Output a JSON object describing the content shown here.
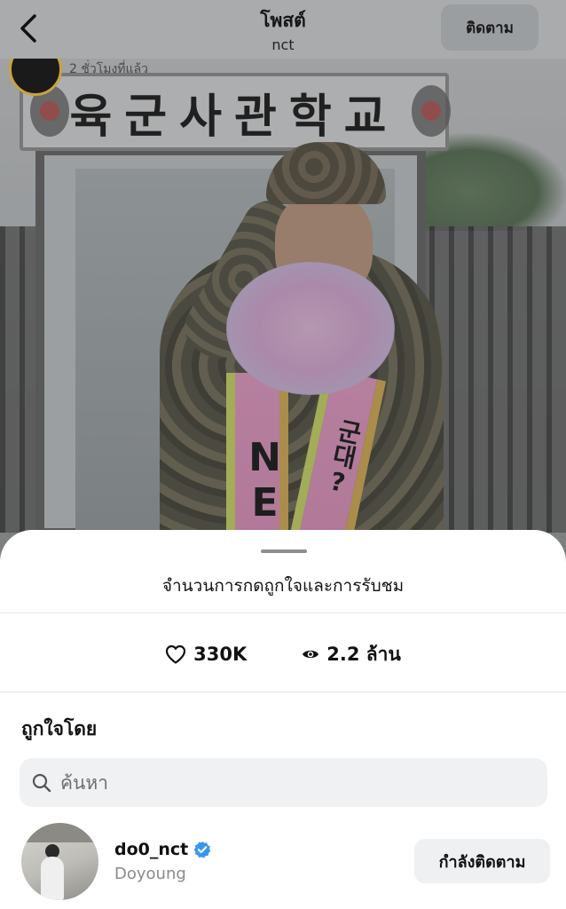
{
  "header": {
    "title": "โพสต์",
    "subtitle": "nct",
    "follow_label": "ติดตาม"
  },
  "post": {
    "time_ago": "2 ชั่วโมงที่แล้ว",
    "photo_sign_text": "육군사관학교",
    "sash_left_text": "NE",
    "sash_right_text": "군대?"
  },
  "sheet": {
    "title": "จำนวนการกดถูกใจและการรับชม",
    "likes_count": "330K",
    "views_count": "2.2 ล้าน",
    "liked_by_label": "ถูกใจโดย",
    "search_placeholder": "ค้นหา"
  },
  "users": [
    {
      "handle": "do0_nct",
      "name": "Doyoung",
      "verified": true,
      "button_label": "กำลังติดตาม"
    }
  ],
  "icons": {
    "back": "chevron-left-icon",
    "like": "heart-icon",
    "views": "eye-icon",
    "search": "search-icon",
    "verified": "verified-badge-icon"
  },
  "colors": {
    "verified_blue": "#3897f0",
    "header_overlay": "#a9abad",
    "button_bg": "#eff0f2"
  }
}
